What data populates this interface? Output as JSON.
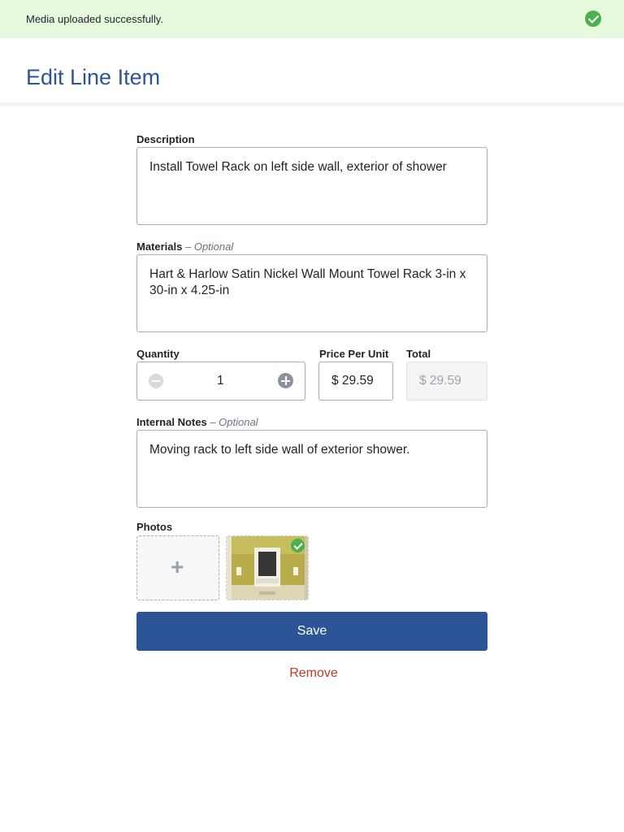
{
  "toast": {
    "message": "Media uploaded successfully.",
    "icon": "check-circle-icon"
  },
  "header": {
    "title": "Edit Line Item"
  },
  "form": {
    "description": {
      "label": "Description",
      "value": "Install Towel Rack on left side wall, exterior of shower"
    },
    "materials": {
      "label": "Materials",
      "optional": "– Optional",
      "value": "Hart & Harlow Satin Nickel Wall Mount Towel Rack 3-in x 30-in x 4.25-in"
    },
    "quantity": {
      "label": "Quantity",
      "value": "1"
    },
    "price_per_unit": {
      "label": "Price Per Unit",
      "value": "$ 29.59"
    },
    "total": {
      "label": "Total",
      "value": "$ 29.59"
    },
    "internal_notes": {
      "label": "Internal Notes",
      "optional": "– Optional",
      "value": "Moving rack to left side wall of exterior shower."
    },
    "photos": {
      "label": "Photos",
      "add_symbol": "+",
      "count": 1
    }
  },
  "actions": {
    "save_label": "Save",
    "remove_label": "Remove"
  },
  "colors": {
    "accent": "#2c5597",
    "success": "#4caf50",
    "danger": "#c0392b",
    "toast_bg": "#e6f9dc"
  }
}
